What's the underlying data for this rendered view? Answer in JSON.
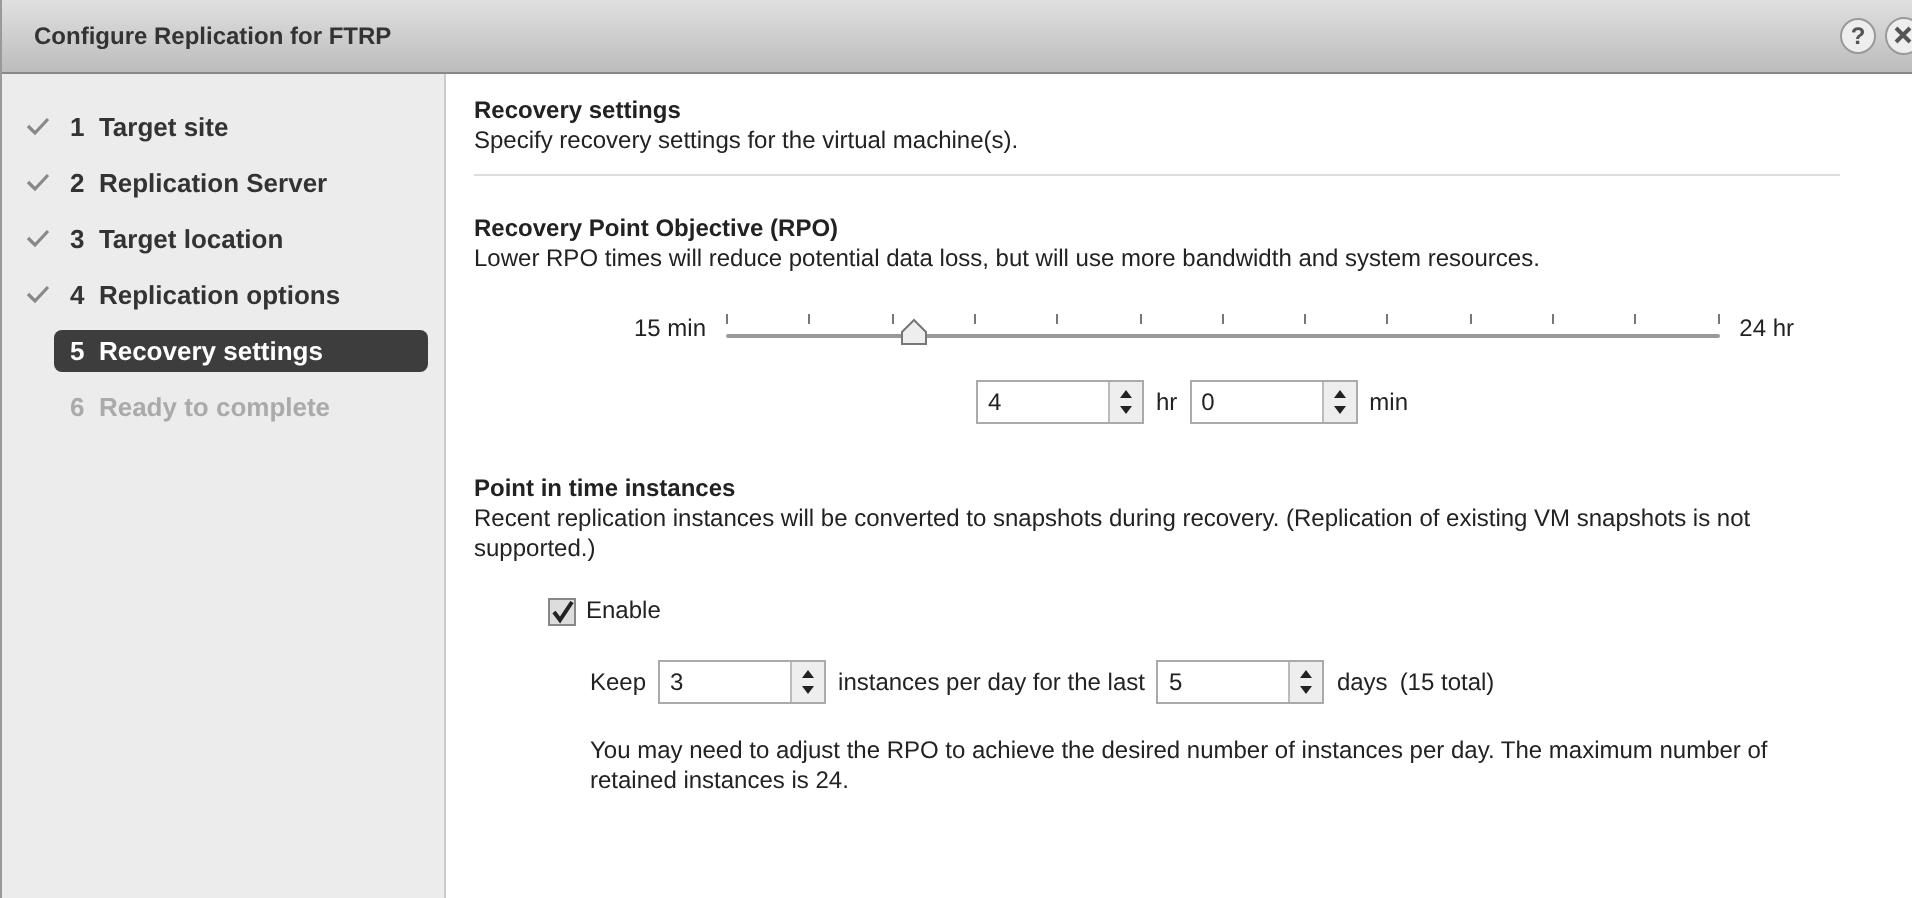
{
  "window": {
    "title": "Configure Replication for FTRP",
    "help": "?"
  },
  "steps": [
    {
      "number": "1",
      "label": "Target site",
      "done": true,
      "selected": false,
      "disabled": false
    },
    {
      "number": "2",
      "label": "Replication Server",
      "done": true,
      "selected": false,
      "disabled": false
    },
    {
      "number": "3",
      "label": "Target location",
      "done": true,
      "selected": false,
      "disabled": false
    },
    {
      "number": "4",
      "label": "Replication options",
      "done": true,
      "selected": false,
      "disabled": false
    },
    {
      "number": "5",
      "label": "Recovery settings",
      "done": false,
      "selected": true,
      "disabled": false
    },
    {
      "number": "6",
      "label": "Ready to complete",
      "done": false,
      "selected": false,
      "disabled": true
    }
  ],
  "header": {
    "title": "Recovery settings",
    "subtitle": "Specify recovery settings for the virtual machine(s)."
  },
  "rpo": {
    "title": "Recovery Point Objective (RPO)",
    "description": "Lower RPO times will reduce potential data loss, but will use more bandwidth and system resources.",
    "min_label": "15 min",
    "max_label": "24 hr",
    "level": 0.19,
    "hours": "4",
    "hours_unit": "hr",
    "minutes": "0",
    "minutes_unit": "min"
  },
  "pit": {
    "title": "Point in time instances",
    "description": "Recent replication instances will be converted to snapshots during recovery. (Replication of existing VM snapshots is not supported.)",
    "enable_label": "Enable",
    "checked": true,
    "keep_label": "Keep",
    "instances": "3",
    "per_day_label": "instances per day for the last",
    "days": "5",
    "days_label": "days",
    "total": "(15 total)",
    "note": "You may need to adjust the RPO to achieve the desired number of instances per day. The maximum number of retained instances is 24."
  }
}
